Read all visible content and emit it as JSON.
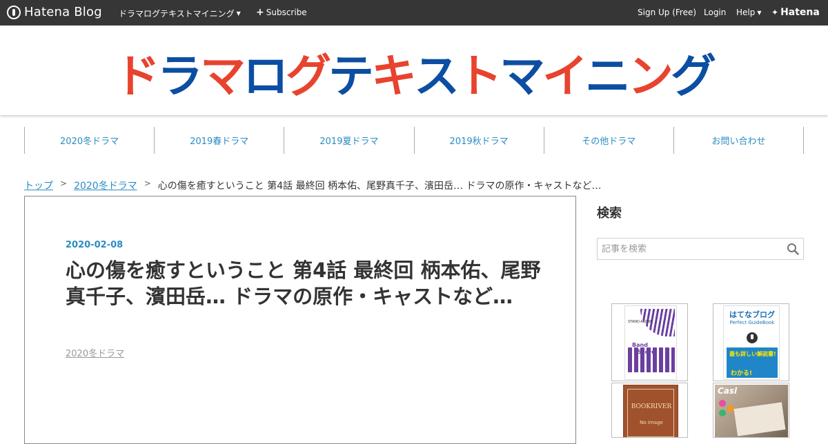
{
  "topbar": {
    "logo_text": "Hatena Blog",
    "blog_menu_label": "ドラマログテキストマイニング",
    "subscribe_label": "Subscribe",
    "signup_label": "Sign Up (Free)",
    "login_label": "Login",
    "help_label": "Help",
    "hatena_label": "Hatena"
  },
  "header": {
    "blog_title_chars": [
      "ド",
      "ラ",
      "マ",
      "ロ",
      "グ",
      "テ",
      "キ",
      "ス",
      "ト",
      "マ",
      "イ",
      "ニ",
      "ン",
      "グ"
    ],
    "title_colors": [
      "#e8432e",
      "#0c4ea2",
      "#e8432e",
      "#0c4ea2",
      "#e8432e",
      "#0c4ea2",
      "#e8432e",
      "#0c4ea2",
      "#e8432e",
      "#0c4ea2",
      "#e8432e",
      "#0c4ea2",
      "#e8432e",
      "#0c4ea2"
    ]
  },
  "nav": {
    "items": [
      {
        "label": "2020冬ドラマ"
      },
      {
        "label": "2019春ドラマ"
      },
      {
        "label": "2019夏ドラマ"
      },
      {
        "label": "2019秋ドラマ"
      },
      {
        "label": "その他ドラマ"
      },
      {
        "label": "お問い合わせ"
      }
    ]
  },
  "breadcrumb": {
    "top": "トップ",
    "separator": ">",
    "category": "2020冬ドラマ",
    "current": "心の傷を癒すということ 第4話 最終回 柄本佑、尾野真千子、濱田岳… ドラマの原作・キャストなど…"
  },
  "article": {
    "date": "2020-02-08",
    "title": "心の傷を癒すということ 第4話 最終回 柄本佑、尾野真千子、濱田岳… ドラマの原作・キャストなど…",
    "category": "2020冬ドラマ"
  },
  "sidebar": {
    "search_heading": "検索",
    "search_placeholder": "記事を検索",
    "ads": [
      {
        "label_1": "Band",
        "label_2": "Score",
        "label_3": "STAND-ALONE"
      },
      {
        "title": "はてなブログ",
        "subtitle": "Perfect GuideBook",
        "tag_1": "最も詳しい解説書!",
        "tag_2": "わかる!"
      },
      {
        "title": "BOOKRIVER",
        "subtitle": "No Image"
      },
      {
        "title": "Casl"
      }
    ]
  },
  "colors": {
    "topbar_bg": "#363636",
    "link_blue": "#2a8cc4",
    "title_red": "#e8432e",
    "title_blue": "#0c4ea2"
  }
}
